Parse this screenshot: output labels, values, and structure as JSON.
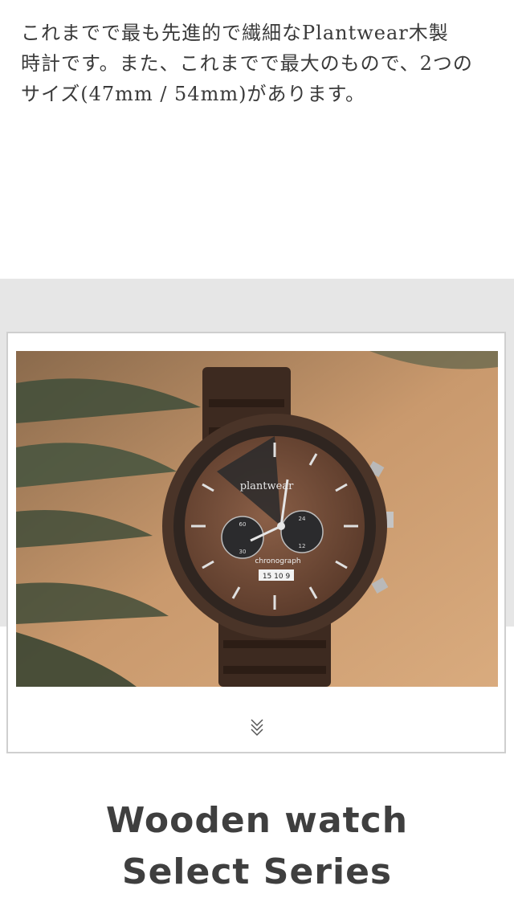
{
  "intro": {
    "lines": [
      "これまでで最も先進的で繊細なPlantwear木製",
      "時計です。また、これまでで最大のもので、2つの",
      "サイズ(47mm / 54mm)があります。"
    ]
  },
  "product_image": {
    "brand_text": "plantwear",
    "dial_text": "chronograph",
    "date_text": "15 10 9",
    "subdial_numbers": [
      "60",
      "30",
      "24",
      "12"
    ]
  },
  "scroll_hint": {
    "icon": "double-chevron-down-icon"
  },
  "heading": {
    "line1": "Wooden watch",
    "line2": "Select Series"
  },
  "colors": {
    "band_gray": "#e6e6e6",
    "card_border": "#cfcfcf",
    "text": "#3f3f3f",
    "wood_dark": "#4a3428",
    "wood_light": "#a47a5c"
  }
}
